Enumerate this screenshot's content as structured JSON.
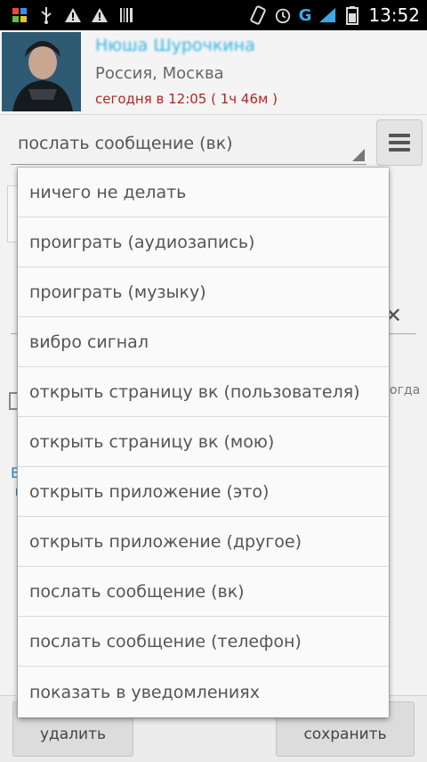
{
  "status_bar": {
    "time": "13:52",
    "network": "G",
    "left_icons": [
      "gallery-icon",
      "usb-icon",
      "warning-icon",
      "warning-icon",
      "barcode-icon"
    ],
    "right_icons": [
      "rotate-icon",
      "alarm-icon",
      "signal-icon",
      "battery-icon"
    ]
  },
  "profile": {
    "name": "Нюша Шурочкина",
    "location": "Россия, Москва",
    "last_seen": "сегодня в 12:05 ( 1ч 46м  )"
  },
  "action": {
    "selected": "послать сообщение (вк)"
  },
  "background": {
    "partial_text": "огда",
    "partial_link": "В"
  },
  "dropdown": {
    "options": [
      "ничего не делать",
      "проиграть (аудиозапись)",
      "проиграть (музыку)",
      "вибро сигнал",
      "открыть страницу вк (пользователя)",
      "открыть страницу вк (мою)",
      "открыть приложение (это)",
      "открыть приложение (другое)",
      "послать сообщение (вк)",
      "послать сообщение (телефон)",
      "показать в уведомлениях"
    ]
  },
  "bottom": {
    "delete_label": "удалить",
    "save_label": "сохранить"
  }
}
